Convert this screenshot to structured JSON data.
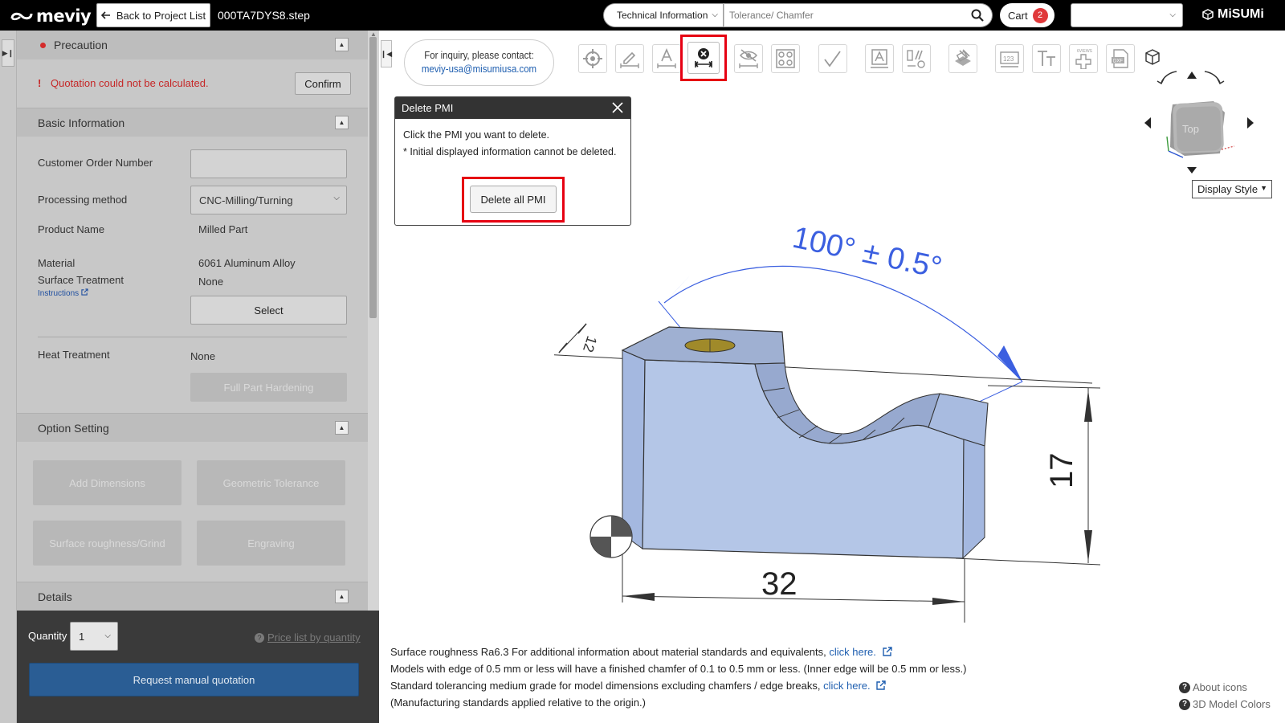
{
  "header": {
    "logo_text": "meviy",
    "back_label": "Back to Project List",
    "file_name": "000TA7DYS8.step",
    "search_category": "Technical Information",
    "search_placeholder": "Tolerance/ Chamfer",
    "cart_label": "Cart",
    "cart_count": "2",
    "language_value": "",
    "brand": "MiSUMi"
  },
  "sidebar": {
    "precaution": {
      "title": "Precaution",
      "error_mark": "!",
      "error_text": "Quotation could not be calculated.",
      "confirm_label": "Confirm"
    },
    "basic_info": {
      "title": "Basic Information",
      "customer_order_label": "Customer Order Number",
      "customer_order_value": "",
      "processing_label": "Processing method",
      "processing_value": "CNC-Milling/Turning",
      "product_name_label": "Product Name",
      "product_name_value": "Milled Part",
      "material_label": "Material",
      "material_value": "6061 Aluminum Alloy",
      "surface_label": "Surface Treatment",
      "surface_value": "None",
      "instructions_label": "Instructions",
      "select_label": "Select",
      "heat_label": "Heat Treatment",
      "heat_value": "None",
      "hardening_label": "Full Part Hardening"
    },
    "option_setting": {
      "title": "Option Setting",
      "buttons": [
        "Add Dimensions",
        "Geometric Tolerance",
        "Surface roughness/Grind",
        "Engraving"
      ]
    },
    "details": {
      "title": "Details"
    },
    "quantity_label": "Quantity",
    "quantity_value": "1",
    "price_link": "Price list by quantity",
    "request_label": "Request manual quotation"
  },
  "viewer": {
    "contact_line1": "For inquiry, please contact:",
    "contact_email": "meviy-usa@misumiusa.com",
    "toolbar_icons": [
      "origin-icon",
      "pencil-dimension-icon",
      "text-dimension-icon",
      "delete-pmi-icon",
      "hide-pmi-icon",
      "pattern-icon",
      "surface-roughness-icon",
      "annotation-icon",
      "tolerance-icon",
      "section-icon",
      "numbering-icon",
      "text-size-icon",
      "6views-icon",
      "dxf-icon"
    ],
    "toolbar_small_labels": {
      "six_views": "6VIEWS",
      "dxf": "DXF",
      "numbering": "123"
    },
    "popup": {
      "title": "Delete PMI",
      "line1": "Click the PMI you want to delete.",
      "line2": "* Initial displayed information cannot be deleted.",
      "button": "Delete all PMI"
    },
    "cube_face": "Top",
    "display_style": "Display Style",
    "dimensions": {
      "angle": "100° ± 0.5°",
      "height": "17",
      "width": "32",
      "depth": "12"
    },
    "notes": {
      "line1": "Surface roughness Ra6.3    For additional information about material standards and equivalents,",
      "line1_link": "click here.",
      "line2": "Models with edge of 0.5 mm or less will have a finished chamfer of 0.1 to 0.5 mm or less. (Inner edge will be 0.5 mm or less.)",
      "line3": "Standard tolerancing medium grade for model dimensions excluding chamfers / edge breaks,",
      "line3_link": "click here.",
      "line4": "(Manufacturing standards applied relative to the origin.)"
    },
    "help": {
      "about_icons": "About icons",
      "model_colors": "3D Model Colors"
    }
  },
  "colors": {
    "model_fill": "#b4c6e7",
    "model_top": "#9fb0d2",
    "dimension_blue": "#3b5fe0",
    "highlight_red": "#e60012",
    "hole_fill": "#a08a2a"
  }
}
